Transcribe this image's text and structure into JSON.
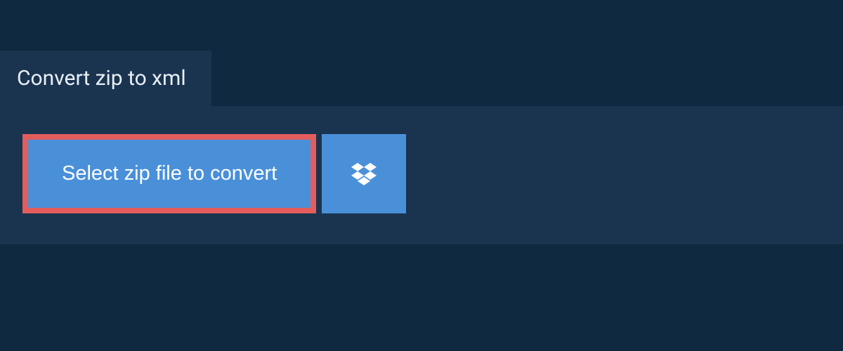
{
  "tab": {
    "title": "Convert zip to xml"
  },
  "upload": {
    "select_label": "Select zip file to convert"
  },
  "colors": {
    "background": "#0f2940",
    "panel": "#1a3450",
    "button": "#4a90d9",
    "highlight_border": "#e45d5d"
  }
}
